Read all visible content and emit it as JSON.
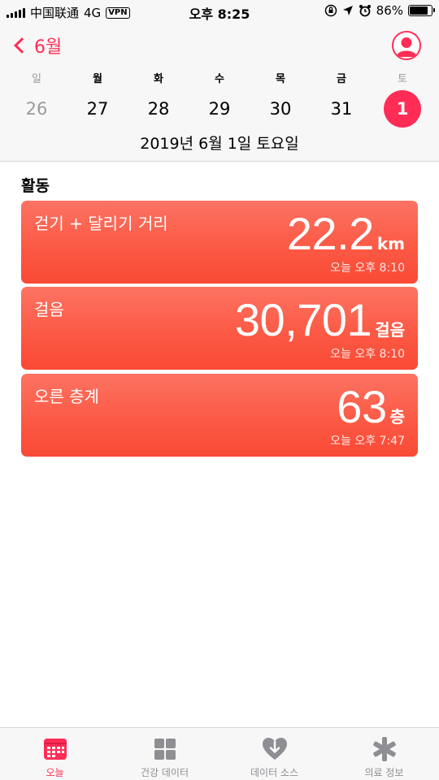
{
  "status_bar": {
    "carrier": "中国联通",
    "network": "4G",
    "vpn": "VPN",
    "time": "오후 8:25",
    "battery_percent_label": "86%",
    "battery_level": 0.86
  },
  "nav": {
    "back_label": "6월",
    "weekdays": [
      "일",
      "월",
      "화",
      "수",
      "목",
      "금",
      "토"
    ],
    "days": [
      "26",
      "27",
      "28",
      "29",
      "30",
      "31",
      "1"
    ],
    "selected_day": "1",
    "date_caption": "2019년 6월 1일 토요일"
  },
  "section": {
    "title": "활동"
  },
  "cards": [
    {
      "title": "걷기 + 달리기 거리",
      "value": "22.2",
      "unit": "km",
      "time": "오늘 오후 8:10"
    },
    {
      "title": "걸음",
      "value": "30,701",
      "unit": "걸음",
      "time": "오늘 오후 8:10"
    },
    {
      "title": "오른 층계",
      "value": "63",
      "unit": "층",
      "time": "오늘 오후 7:47"
    }
  ],
  "tab_bar": {
    "tabs": [
      {
        "label": "오늘",
        "icon": "today-icon",
        "active": true
      },
      {
        "label": "건강 데이터",
        "icon": "health-data-grid-icon",
        "active": false
      },
      {
        "label": "데이터 소스",
        "icon": "data-source-heart-icon",
        "active": false
      },
      {
        "label": "의료 정보",
        "icon": "medical-id-asterisk-icon",
        "active": false
      }
    ]
  },
  "colors": {
    "accent": "#ff2d55",
    "card_top": "#fd7363",
    "card_bottom": "#f94a35",
    "muted": "#9b9b9b",
    "tab_inactive": "#8e8e93"
  }
}
